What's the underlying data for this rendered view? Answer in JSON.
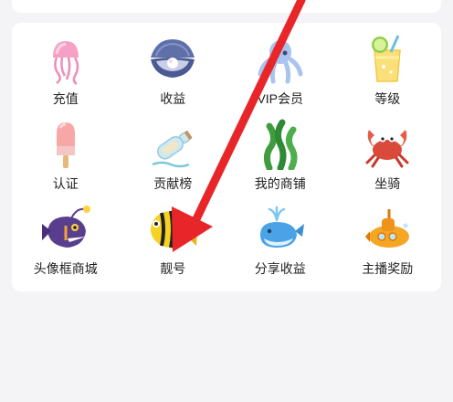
{
  "grid": {
    "items": [
      {
        "label": "充值",
        "icon": "jellyfish-icon"
      },
      {
        "label": "收益",
        "icon": "pearl-shell-icon"
      },
      {
        "label": "VIP会员",
        "icon": "octopus-icon"
      },
      {
        "label": "等级",
        "icon": "lemonade-drink-icon"
      },
      {
        "label": "认证",
        "icon": "popsicle-icon"
      },
      {
        "label": "贡献榜",
        "icon": "message-bottle-icon"
      },
      {
        "label": "我的商铺",
        "icon": "seaweed-icon"
      },
      {
        "label": "坐骑",
        "icon": "crab-icon"
      },
      {
        "label": "头像框商城",
        "icon": "anglerfish-icon"
      },
      {
        "label": "靓号",
        "icon": "yellow-fish-icon"
      },
      {
        "label": "分享收益",
        "icon": "whale-icon"
      },
      {
        "label": "主播奖励",
        "icon": "submarine-icon"
      }
    ]
  },
  "colors": {
    "background": "#f4f4f6",
    "card": "#ffffff",
    "arrow": "#e8262a",
    "text": "#222222"
  }
}
